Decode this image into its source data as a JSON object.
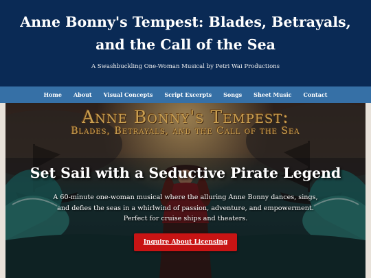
{
  "header": {
    "title": "Anne Bonny's Tempest: Blades, Betrayals, and the Call of the Sea",
    "tagline": "A Swashbuckling One-Woman Musical by Petri Wai Productions"
  },
  "nav": {
    "items": [
      "Home",
      "About",
      "Visual Concepts",
      "Script Excerpts",
      "Songs",
      "Sheet Music",
      "Contact"
    ]
  },
  "hero": {
    "banner_line1": "Anne Bonny's Tempest:",
    "banner_line2": "Blades, Betrayals, and the Call of the Sea",
    "heading": "Set Sail with a Seductive Pirate Legend",
    "text": "A 60-minute one-woman musical where the alluring Anne Bonny dances, sings, and defies the seas in a whirlwind of passion, adventure, and empowerment. Perfect for cruise ships and theaters.",
    "cta_label": "Inquire About Licensing"
  },
  "colors": {
    "header_bg": "#0a2a55",
    "nav_bg": "#3670a6",
    "cta_bg": "#c81414"
  }
}
